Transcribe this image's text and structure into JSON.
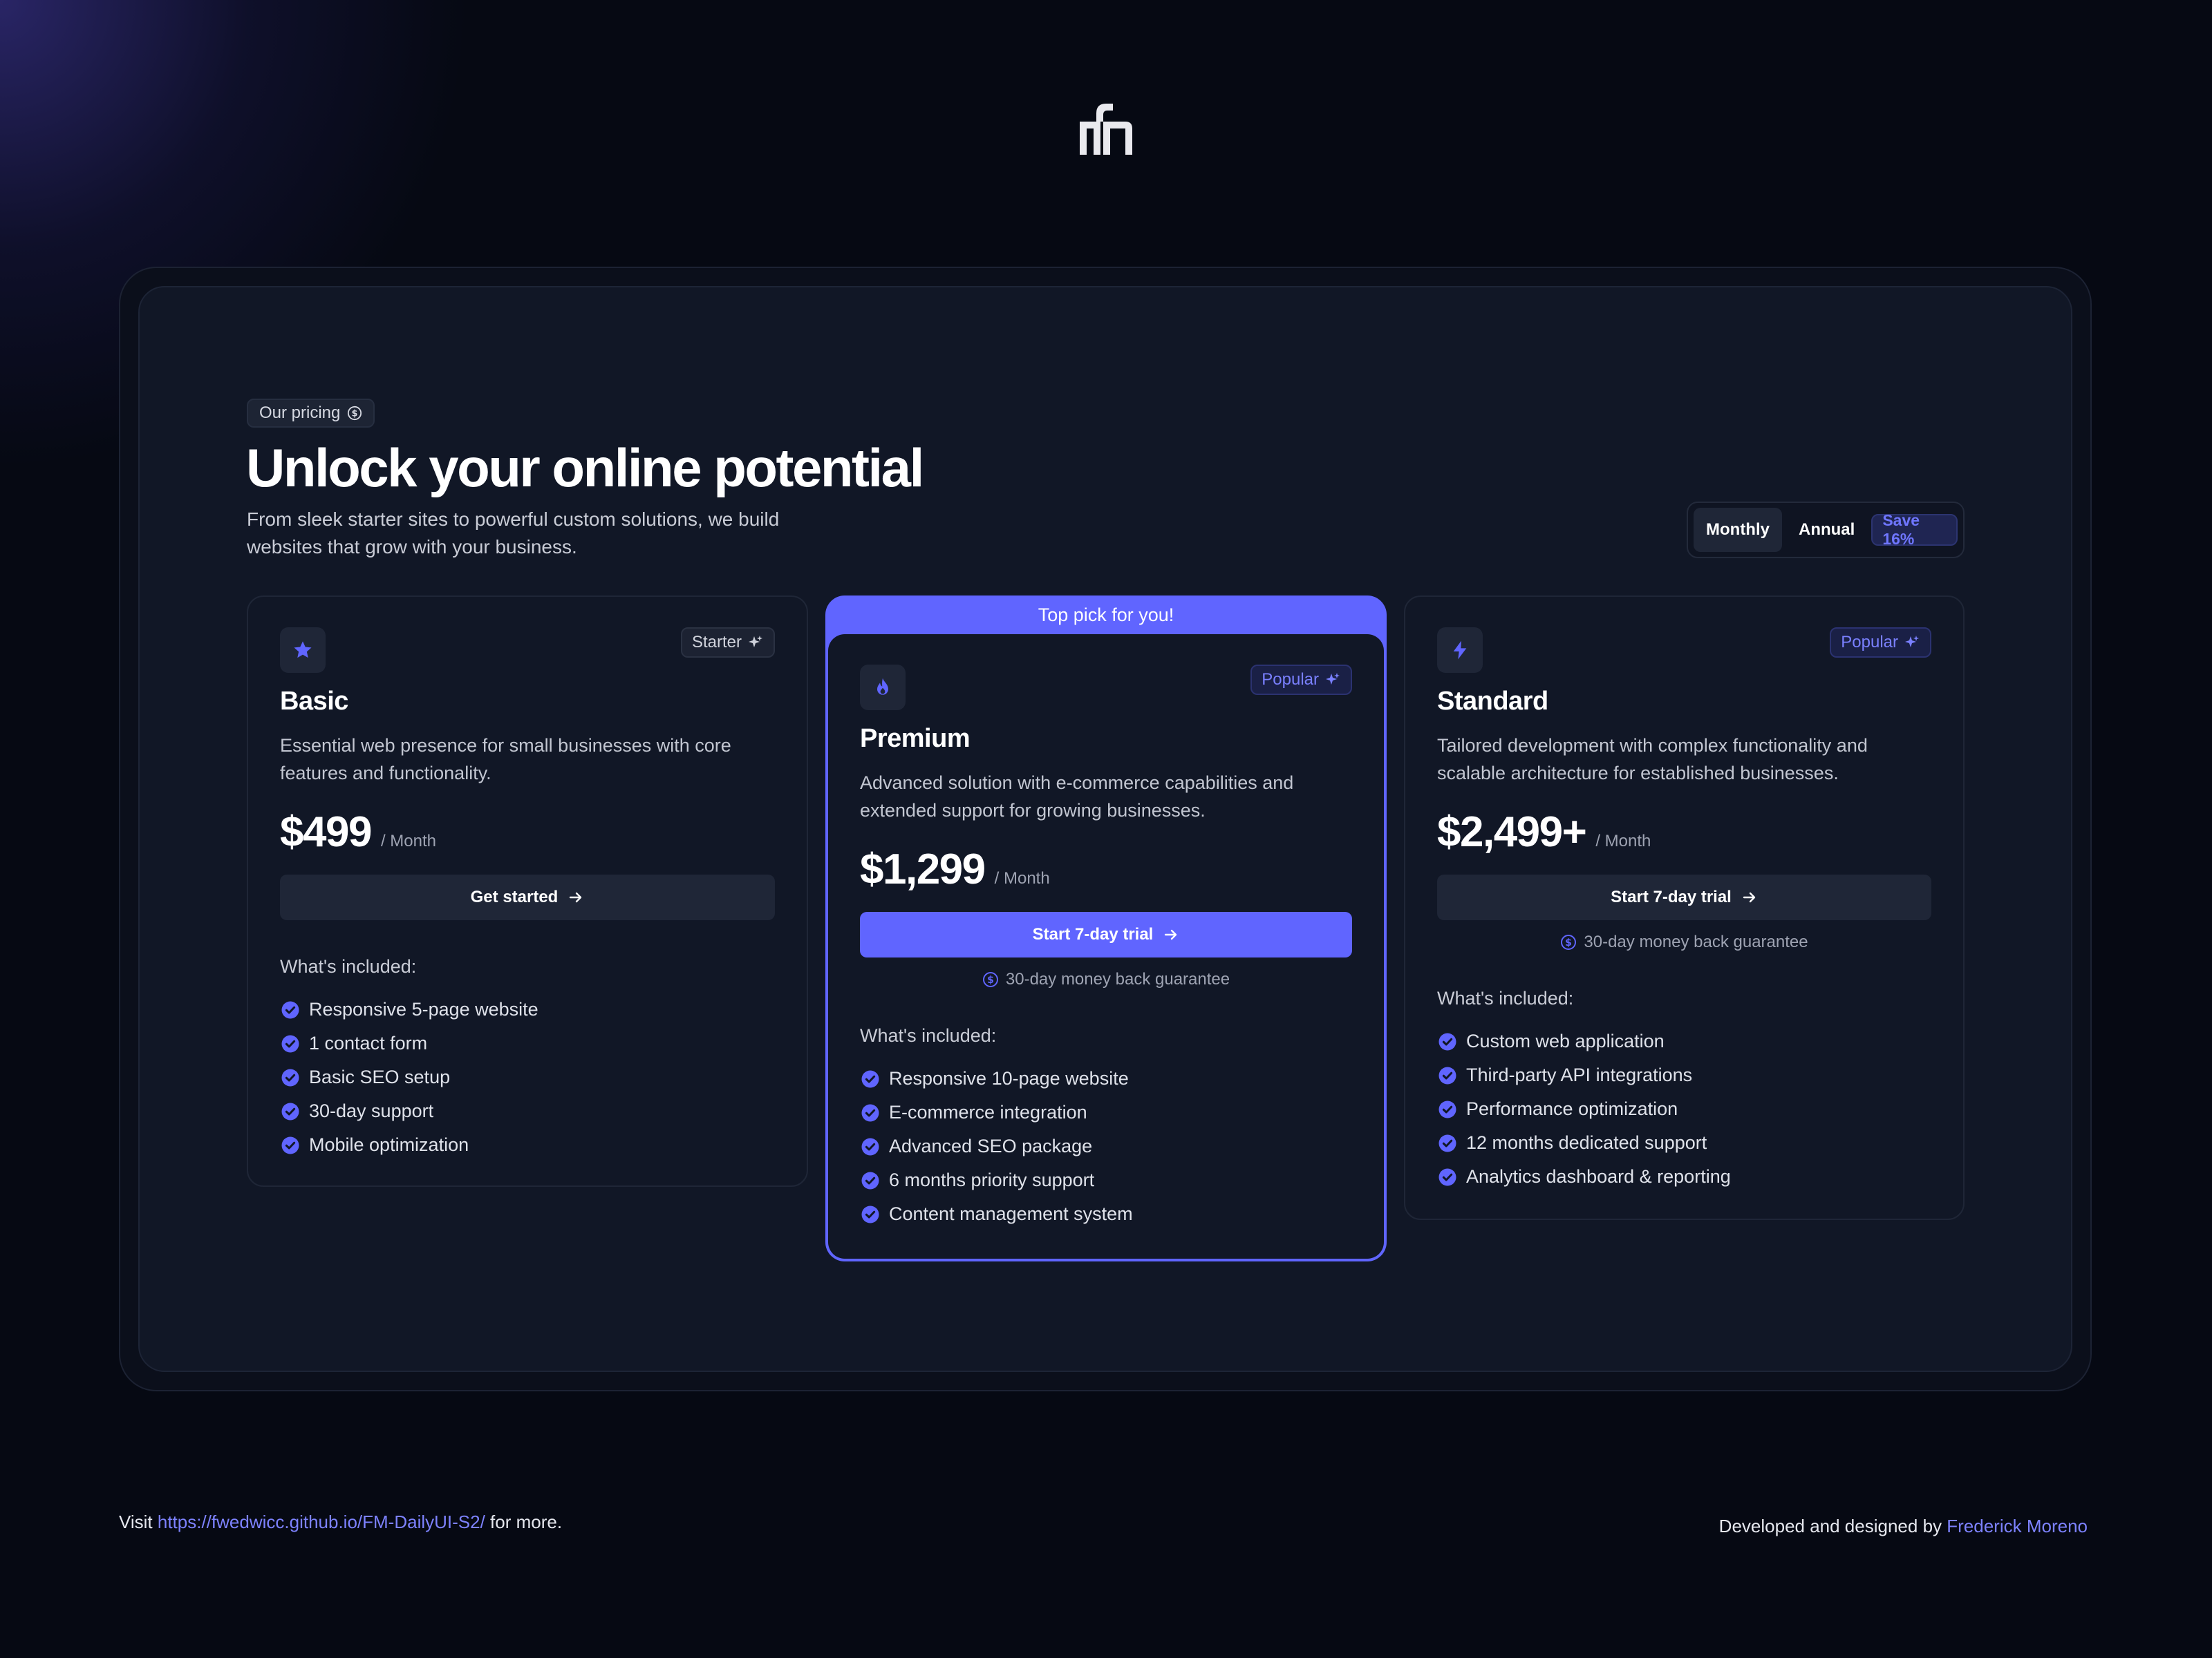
{
  "brand": {
    "logo_icon": "mfn-logo-icon"
  },
  "header": {
    "chip_label": "Our pricing",
    "title": "Unlock your online potential",
    "subtitle": "From sleek starter sites to powerful custom solutions, we build websites that grow with your business."
  },
  "billing": {
    "monthly_label": "Monthly",
    "annual_label": "Annual",
    "save_label": "Save 16%",
    "selected": "Monthly"
  },
  "colors": {
    "accent": "#6065ff",
    "background": "#060913",
    "panel": "#111726"
  },
  "plans": [
    {
      "icon": "star-icon",
      "badge": "Starter",
      "name": "Basic",
      "description": "Essential web presence for small businesses with core features and functionality.",
      "price": "$499",
      "period": "/ Month",
      "cta": "Get started",
      "guarantee": "",
      "included_title": "What's included:",
      "features": [
        "Responsive 5-page website",
        "1 contact form",
        "Basic SEO setup",
        "30-day support",
        "Mobile optimization"
      ]
    },
    {
      "banner": "Top pick for you!",
      "icon": "flame-icon",
      "badge": "Popular",
      "name": "Premium",
      "description": "Advanced solution with e-commerce capabilities and extended support for growing businesses.",
      "price": "$1,299",
      "period": "/ Month",
      "cta": "Start 7-day trial",
      "guarantee": "30-day money back guarantee",
      "included_title": "What's included:",
      "features": [
        "Responsive 10-page website",
        "E-commerce integration",
        "Advanced SEO package",
        "6 months priority support",
        "Content management system"
      ]
    },
    {
      "icon": "lightning-icon",
      "badge": "Popular",
      "name": "Standard",
      "description": "Tailored development with complex functionality and scalable architecture for established businesses.",
      "price": "$2,499+",
      "period": "/ Month",
      "cta": "Start 7-day trial",
      "guarantee": "30-day money back guarantee",
      "included_title": "What's included:",
      "features": [
        "Custom web application",
        "Third-party API integrations",
        "Performance optimization",
        "12 months dedicated support",
        "Analytics dashboard & reporting"
      ]
    }
  ],
  "footer": {
    "visit_prefix": "Visit ",
    "visit_link": "https://fwedwicc.github.io/FM-DailyUI-S2/",
    "visit_suffix": " for more.",
    "credit_prefix": "Developed and designed by ",
    "credit_name": "Frederick Moreno"
  }
}
